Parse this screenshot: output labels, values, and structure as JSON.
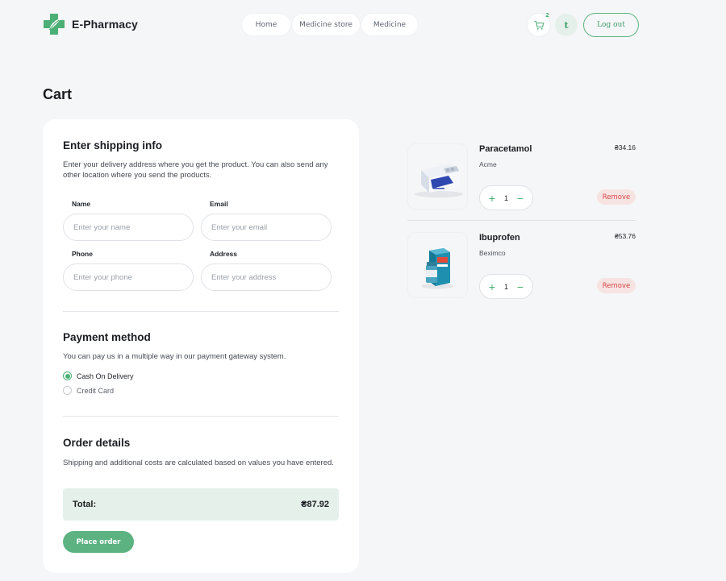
{
  "brand": {
    "name": "E-Pharmacy",
    "accent": "#4caf75",
    "icon": "pharmacy-cross-icon"
  },
  "nav": {
    "items": [
      {
        "label": "Home"
      },
      {
        "label": "Medicine store"
      },
      {
        "label": "Medicine"
      }
    ]
  },
  "header": {
    "cart_count": "2",
    "cart_icon": "cart-icon",
    "avatar_initial": "t",
    "logout_label": "Log out"
  },
  "page": {
    "title": "Cart"
  },
  "shipping": {
    "title": "Enter shipping info",
    "description": "Enter your delivery address where you get the product. You can also send any other location where you send the products.",
    "fields": {
      "name": {
        "label": "Name",
        "placeholder": "Enter your name",
        "value": ""
      },
      "email": {
        "label": "Email",
        "placeholder": "Enter your email",
        "value": ""
      },
      "phone": {
        "label": "Phone",
        "placeholder": "Enter your phone",
        "value": ""
      },
      "address": {
        "label": "Address",
        "placeholder": "Enter your address",
        "value": ""
      }
    }
  },
  "payment": {
    "title": "Payment method",
    "description": "You can pay us in a multiple way in our payment gateway system.",
    "options": [
      {
        "label": "Cash On Delivery",
        "selected": true
      },
      {
        "label": "Credit Card",
        "selected": false
      }
    ]
  },
  "order": {
    "title": "Order details",
    "description": "Shipping and additional costs are calculated based on values you have entered.",
    "total_label": "Total:",
    "total_value": "₴87.92",
    "place_order_label": "Place order"
  },
  "cart_items": [
    {
      "name": "Paracetamol",
      "maker": "Acme",
      "price": "₴34.16",
      "quantity": "1",
      "remove_label": "Remove",
      "image": "paracetamol-package-image"
    },
    {
      "name": "Ibuprofen",
      "maker": "Beximco",
      "price": "₴53.76",
      "quantity": "1",
      "remove_label": "Remove",
      "image": "ibuprofen-bottle-image"
    }
  ]
}
